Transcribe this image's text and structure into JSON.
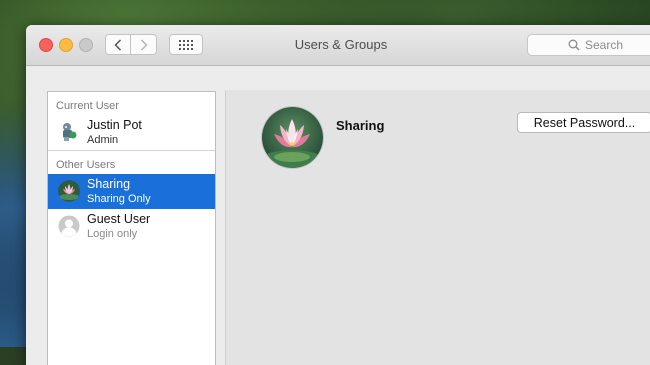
{
  "window": {
    "title": "Users & Groups",
    "search_placeholder": "Search"
  },
  "sidebar": {
    "current_user_heading": "Current User",
    "current_user": {
      "name": "Justin Pot",
      "role": "Admin"
    },
    "other_users_heading": "Other Users",
    "other_users": [
      {
        "name": "Sharing",
        "role": "Sharing Only",
        "selected": true
      },
      {
        "name": "Guest User",
        "role": "Login only",
        "selected": false
      }
    ]
  },
  "detail": {
    "user_name": "Sharing",
    "reset_password_label": "Reset Password..."
  },
  "colors": {
    "selection": "#1a6fd8",
    "close": "#fc605c",
    "minimize": "#fdbc40"
  }
}
